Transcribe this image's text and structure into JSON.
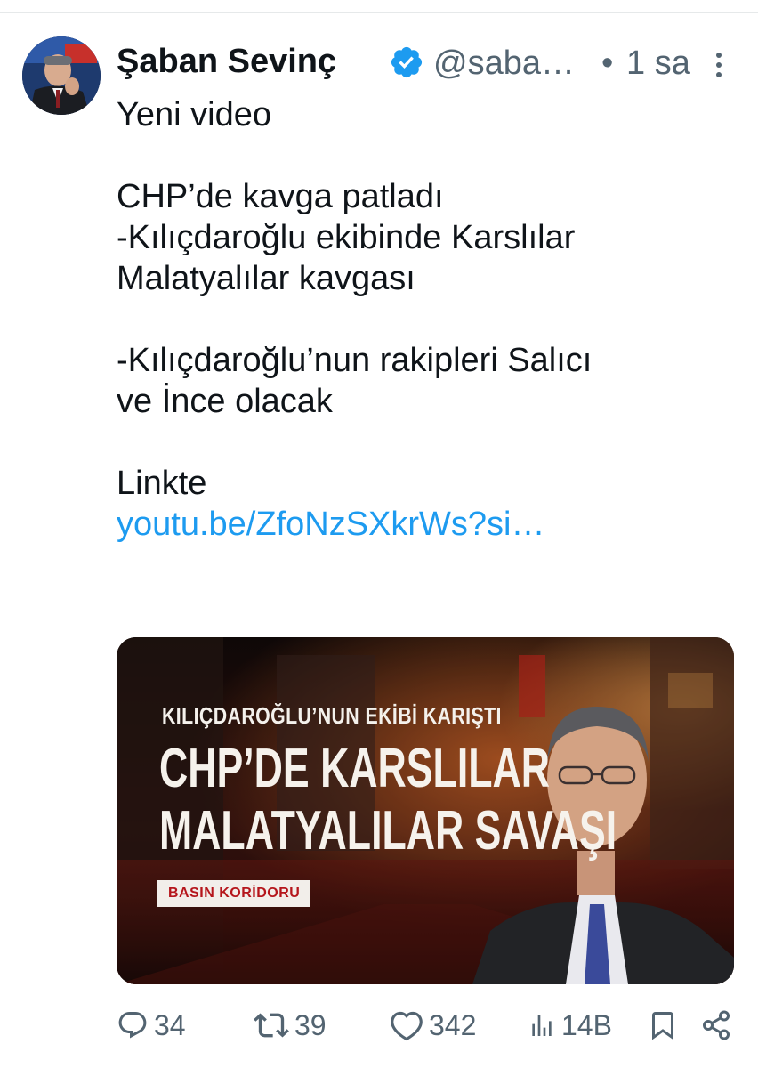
{
  "tweet": {
    "author_name": "Şaban Sevinç",
    "handle": "@saba…",
    "separator": "•",
    "time": "1 sa",
    "text": "Yeni video\n\nCHP’de kavga patladı\n-Kılıçdaroğlu ekibinde Karslılar\nMalatyalılar kavgası\n\n-Kılıçdaroğlu’nun rakipleri Salıcı\nve İnce olacak\n\nLinkte",
    "link": "youtu.be/ZfoNzSXkrWs?si…"
  },
  "media": {
    "kicker": "KILIÇDAROĞLU’NUN EKİBİ KARIŞTI",
    "headline_line1": "CHP’DE KARSLILAR",
    "headline_line2": "MALATYALILAR SAVAŞI",
    "badge": "BASIN KORİDORU"
  },
  "actions": {
    "replies": "34",
    "reposts": "39",
    "likes": "342",
    "views": "14B"
  },
  "icons": {
    "verified": "verified-badge-icon",
    "more": "more-options-icon",
    "reply": "reply-icon",
    "repost": "repost-icon",
    "like": "heart-icon",
    "views": "views-chart-icon",
    "bookmark": "bookmark-icon",
    "share": "share-icon"
  },
  "colors": {
    "text": "#0f1419",
    "secondary": "#536471",
    "link": "#1d9bf0",
    "verified": "#1d9bf0"
  }
}
